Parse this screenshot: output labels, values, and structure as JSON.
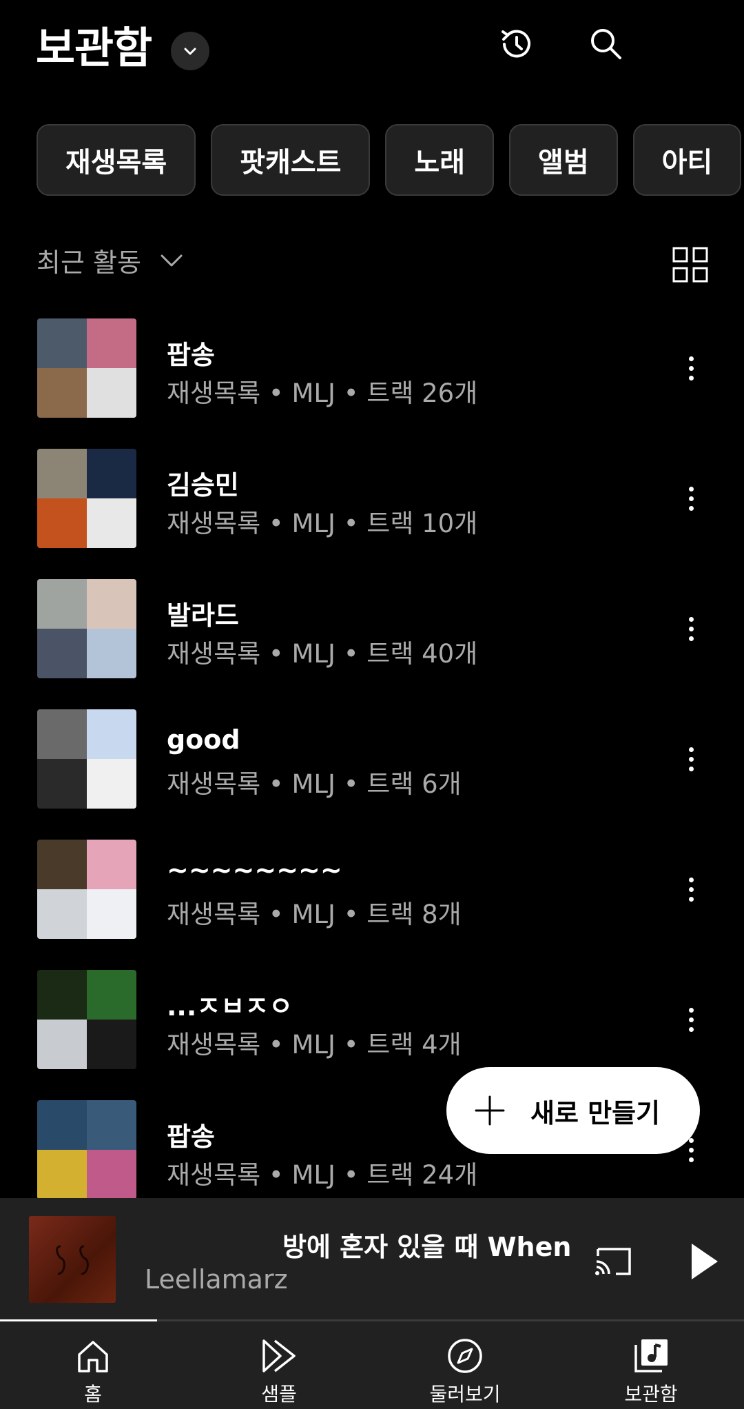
{
  "header": {
    "title": "보관함"
  },
  "chips": [
    "재생목록",
    "팟캐스트",
    "노래",
    "앨범",
    "아티"
  ],
  "sort": {
    "label": "최근 활동"
  },
  "items": [
    {
      "title": "팝송",
      "subtitle": "재생목록 • MLJ • 트랙 26개",
      "colors": [
        "#4d5a6a",
        "#c46b86",
        "#8a6a4a",
        "#e0e0e0"
      ]
    },
    {
      "title": "김승민",
      "subtitle": "재생목록 • MLJ • 트랙 10개",
      "colors": [
        "#8c8474",
        "#1a2a44",
        "#c4521e",
        "#e8e8e8"
      ]
    },
    {
      "title": "발라드",
      "subtitle": "재생목록 • MLJ • 트랙 40개",
      "colors": [
        "#a0a4a0",
        "#d8c4b8",
        "#4a5466",
        "#b4c4d8"
      ]
    },
    {
      "title": "good",
      "subtitle": "재생목록 • MLJ • 트랙 6개",
      "colors": [
        "#6a6a6a",
        "#c8d8ee",
        "#2a2a2a",
        "#f0f0f0"
      ]
    },
    {
      "title": "~~~~~~~~",
      "subtitle": "재생목록 • MLJ • 트랙 8개",
      "colors": [
        "#4a3a2a",
        "#e6a4b8",
        "#d0d4d8",
        "#eef0f4"
      ]
    },
    {
      "title": "...ㅈㅂㅈㅇ",
      "subtitle": "재생목록 • MLJ • 트랙 4개",
      "colors": [
        "#1a2a14",
        "#2a6a2a",
        "#c8ccd0",
        "#1a1a1a"
      ]
    },
    {
      "title": "팝송",
      "subtitle": "재생목록 • MLJ • 트랙 24개",
      "colors": [
        "#2a4a6a",
        "#3a5a7a",
        "#d4b030",
        "#c05a8a"
      ]
    }
  ],
  "fab": {
    "label": "새로 만들기"
  },
  "player": {
    "title": "방에 혼자 있을 때 When Y",
    "artist": "Leellamarz"
  },
  "nav": [
    {
      "label": "홈",
      "icon": "home-icon"
    },
    {
      "label": "샘플",
      "icon": "samples-icon"
    },
    {
      "label": "둘러보기",
      "icon": "explore-icon"
    },
    {
      "label": "보관함",
      "icon": "library-icon"
    }
  ],
  "colors": {
    "background": "#000000",
    "surface": "#212121",
    "subtext": "#aaaaaa",
    "chip_border": "#3a3a3a"
  }
}
